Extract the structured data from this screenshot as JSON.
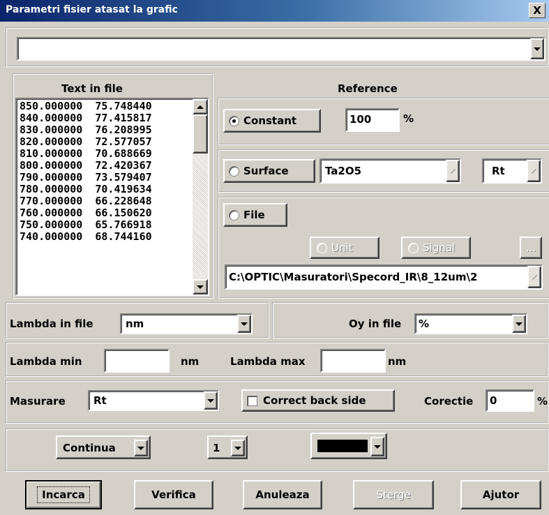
{
  "window": {
    "title": "Parametri fisier atasat la grafic",
    "close_label": "X"
  },
  "top_combo": {
    "value": ""
  },
  "text_in_file": {
    "title": "Text in file",
    "rows": [
      "850.000000  75.748440",
      "840.000000  77.415817",
      "830.000000  76.208995",
      "820.000000  72.577057",
      "810.000000  70.688669",
      "800.000000  72.420367",
      "790.000000  73.579407",
      "780.000000  70.419634",
      "770.000000  66.228648",
      "760.000000  66.150620",
      "750.000000  65.766918",
      "740.000000  68.744160"
    ]
  },
  "reference": {
    "title": "Reference",
    "constant_label": "Constant",
    "constant_value": "100",
    "constant_unit": "%",
    "surface_label": "Surface",
    "surface_material": "Ta2O5",
    "surface_type": "Rt",
    "file_label": "File",
    "unit_label": "Unit",
    "signal_label": "Signal",
    "browse_label": "...",
    "file_path": "C:\\OPTIC\\Masuratori\\Specord_IR\\8_12um\\2"
  },
  "lambda_in_file": {
    "label": "Lambda in file",
    "value": "nm"
  },
  "oy_in_file": {
    "label": "Oy in file",
    "value": "%"
  },
  "lambda_min": {
    "label": "Lambda min",
    "value": "",
    "unit": "nm"
  },
  "lambda_max": {
    "label": "Lambda max",
    "value": "",
    "unit": "nm"
  },
  "masurare": {
    "label": "Masurare",
    "value": "Rt"
  },
  "correct_back_side": {
    "label": "Correct back side",
    "checked": false
  },
  "corectie": {
    "label": "Corectie",
    "value": "0",
    "unit": "%"
  },
  "line_style": {
    "value": "Continua"
  },
  "line_width": {
    "value": "1"
  },
  "line_color": {
    "color": "#000000"
  },
  "buttons": {
    "incarca": "Incarca",
    "verifica": "Verifica",
    "anuleaza": "Anuleaza",
    "sterge": "Sterge",
    "ajutor": "Ajutor"
  }
}
